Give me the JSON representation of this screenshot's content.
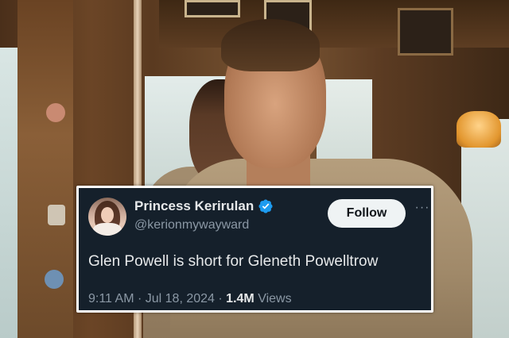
{
  "tweet": {
    "display_name": "Princess Kerirulan",
    "handle": "@kerionmywayward",
    "follow_label": "Follow",
    "more_label": "···",
    "text": "Glen Powell is short for Gleneth Powelltrow",
    "time": "9:11 AM",
    "separator": "·",
    "date": "Jul 18, 2024",
    "views_count": "1.4M",
    "views_label": "Views",
    "verified_color": "#1d9bf0"
  },
  "icons": {
    "verified": "verified-badge-icon",
    "more": "more-options-icon"
  },
  "colors": {
    "card_bg": "#15202b",
    "text_primary": "#e7e9ea",
    "text_secondary": "#8b98a5",
    "button_bg": "#eff3f4"
  }
}
